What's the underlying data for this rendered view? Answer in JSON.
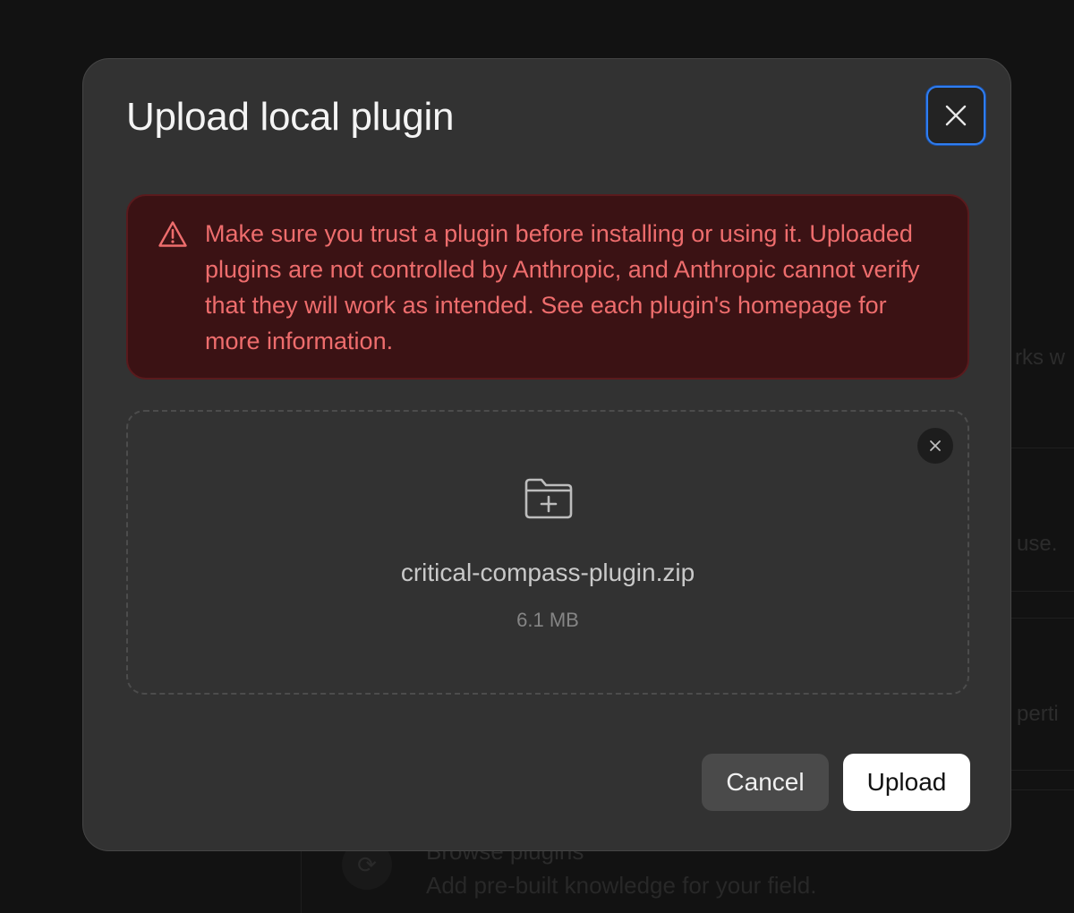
{
  "background": {
    "fragments": [
      "rks w",
      "use.",
      "perti"
    ],
    "item_title": "Browse plugins",
    "item_description": "Add pre-built knowledge for your field."
  },
  "modal": {
    "title": "Upload local plugin",
    "close_icon": "close-icon"
  },
  "warning": {
    "icon": "warning-triangle-icon",
    "text": "Make sure you trust a plugin before installing or using it. Uploaded plugins are not controlled by Anthropic, and Anthropic cannot verify that they will work as intended. See each plugin's homepage for more information.",
    "color": "#ee6d6d"
  },
  "file": {
    "icon": "folder-plus-icon",
    "name": "critical-compass-plugin.zip",
    "size": "6.1 MB"
  },
  "actions": {
    "cancel_label": "Cancel",
    "upload_label": "Upload"
  },
  "colors": {
    "focus_ring": "#2f7df0",
    "modal_bg": "#323232"
  }
}
